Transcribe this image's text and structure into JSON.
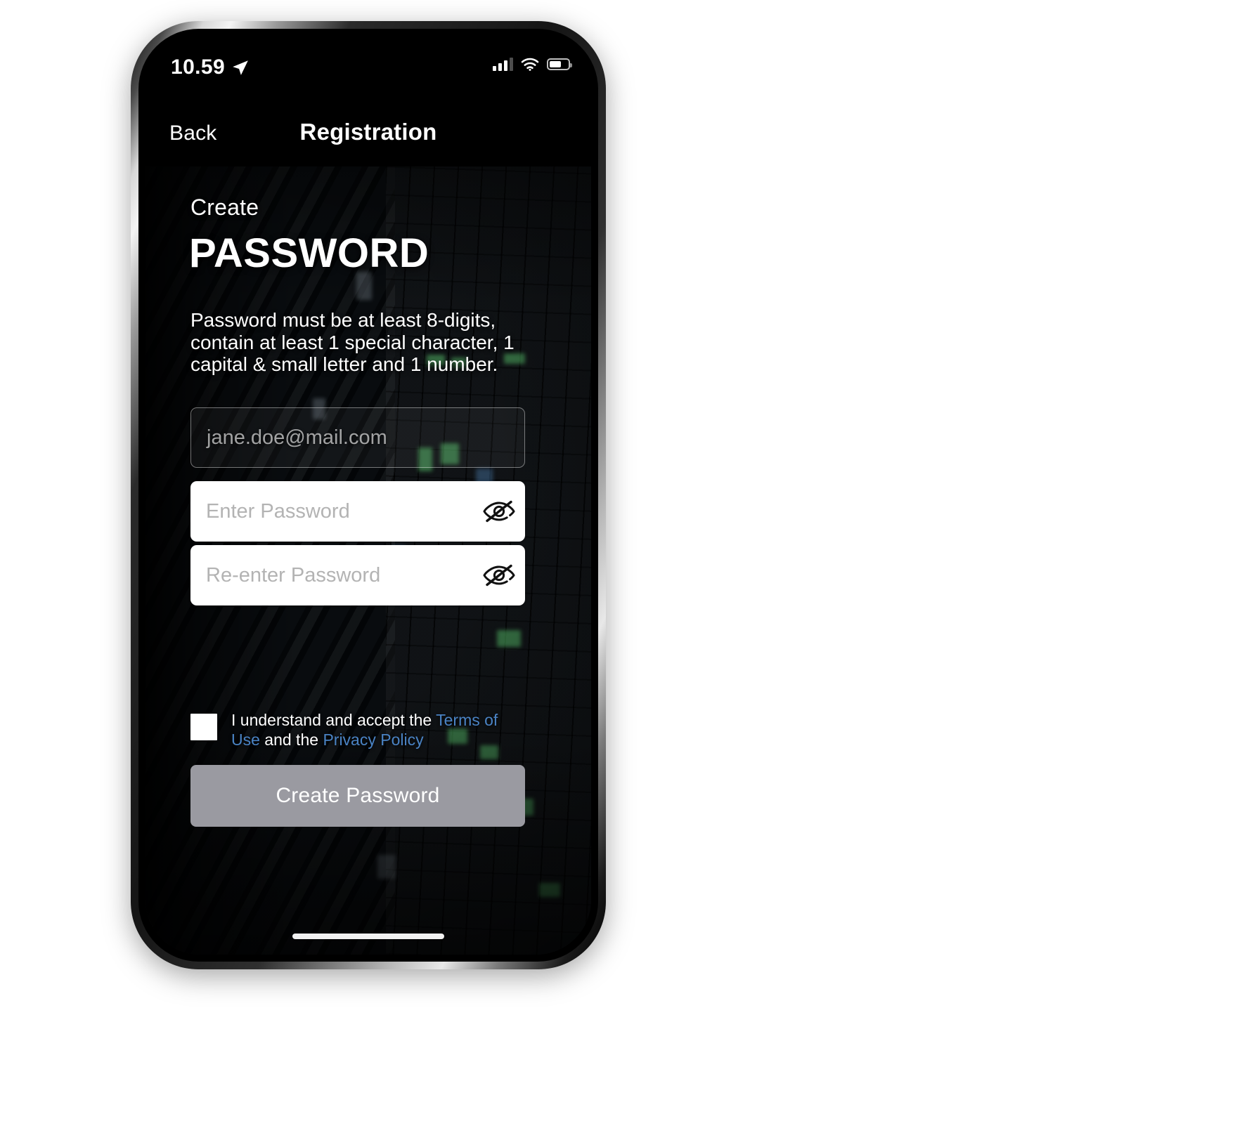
{
  "status_bar": {
    "time": "10.59",
    "location_icon": "location-arrow-icon",
    "cellular_icon": "cellular-bars-icon",
    "wifi_icon": "wifi-icon",
    "battery_icon": "battery-icon"
  },
  "nav": {
    "back_label": "Back",
    "title": "Registration"
  },
  "screen": {
    "kicker": "Create",
    "title": "PASSWORD",
    "description": "Password must be at least 8-digits, contain at least 1 special character, 1 capital & small letter and 1 number."
  },
  "fields": {
    "email": {
      "placeholder": "jane.doe@mail.com",
      "value": ""
    },
    "password": {
      "placeholder": "Enter Password",
      "value": "",
      "toggle_icon": "eye-slash-icon"
    },
    "confirm_password": {
      "placeholder": "Re-enter Password",
      "value": "",
      "toggle_icon": "eye-slash-icon"
    }
  },
  "terms": {
    "checked": false,
    "prefix": "I understand and accept the ",
    "terms_link": "Terms of Use",
    "middle": " and the ",
    "privacy_link": "Privacy Policy"
  },
  "submit": {
    "label": "Create Password"
  },
  "colors": {
    "link_blue": "#4a83c4",
    "button_disabled": "#9a9aa1",
    "field_white": "#ffffff",
    "placeholder_gray": "#b3b3b3",
    "screen_black": "#000000"
  }
}
